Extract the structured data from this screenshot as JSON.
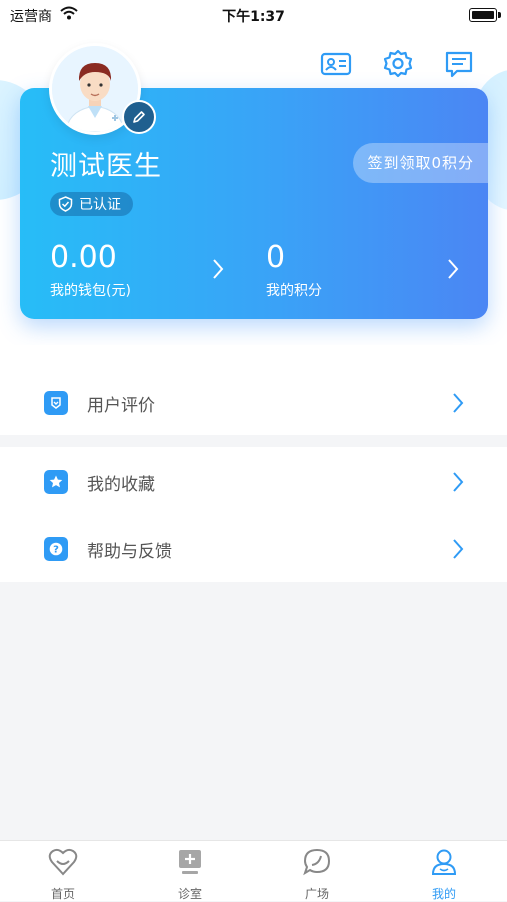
{
  "status_bar": {
    "carrier": "运营商",
    "time": "下午1:37"
  },
  "profile": {
    "name": "测试医生",
    "verified_label": "已认证",
    "checkin_label": "签到领取0积分",
    "wallet": {
      "value": "0.00",
      "label": "我的钱包(元)"
    },
    "points": {
      "value": "0",
      "label": "我的积分"
    }
  },
  "menu": [
    {
      "label": "用户评价",
      "icon": "review-icon"
    },
    {
      "label": "我的收藏",
      "icon": "star-icon"
    },
    {
      "label": "帮助与反馈",
      "icon": "help-icon"
    }
  ],
  "tabs": [
    {
      "label": "首页",
      "icon": "home-smile-icon",
      "active": false
    },
    {
      "label": "诊室",
      "icon": "clinic-icon",
      "active": false
    },
    {
      "label": "广场",
      "icon": "chat-bubble-icon",
      "active": false
    },
    {
      "label": "我的",
      "icon": "person-icon",
      "active": true
    }
  ],
  "colors": {
    "accent": "#2f9bf5",
    "card_start": "#27bdf7",
    "card_end": "#4b86f4"
  }
}
